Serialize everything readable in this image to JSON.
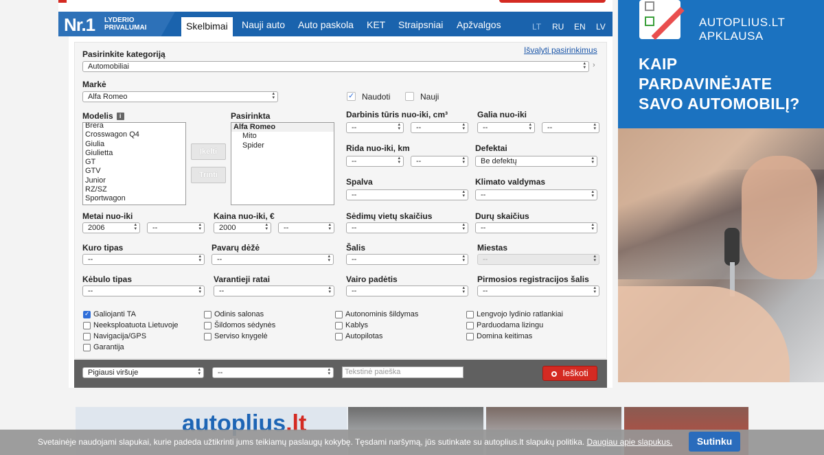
{
  "nav": {
    "logo_nr": "Nr.1",
    "logo_line1": "LYDERIO",
    "logo_line2": "PRIVALUMAI",
    "items": [
      "Skelbimai",
      "Nauji auto",
      "Auto paskola",
      "KET",
      "Straipsniai",
      "Apžvalgos"
    ],
    "languages": [
      "LT",
      "RU",
      "EN",
      "LV"
    ]
  },
  "form": {
    "category_label": "Pasirinkite kategoriją",
    "category_value": "Automobiliai",
    "clear_link": "Išvalyti pasirinkimus",
    "make_label": "Markė",
    "make_value": "Alfa Romeo",
    "used_label": "Naudoti",
    "new_label": "Nauji",
    "model_label": "Modelis",
    "models": [
      "Brera",
      "Crosswagon Q4",
      "Giulia",
      "Giulietta",
      "GT",
      "GTV",
      "Junior",
      "RZ/SZ",
      "Sportwagon"
    ],
    "insert_btn": "Įkelti",
    "delete_btn": "Trinti",
    "selection_label": "Pasirinkta",
    "selection": [
      "Alfa Romeo",
      "Mito",
      "Spider"
    ],
    "engine_label": "Darbinis tūris nuo-iki, cm³",
    "power_label": "Galia nuo-iki",
    "mileage_label": "Rida nuo-iki, km",
    "defects_label": "Defektai",
    "defects_value": "Be defektų",
    "color_label": "Spalva",
    "climate_label": "Klimato valdymas",
    "year_label": "Metai nuo-iki",
    "year_from": "2006",
    "price_label": "Kaina nuo-iki, €",
    "price_from": "2000",
    "seats_label": "Sėdimų vietų skaičius",
    "doors_label": "Durų skaičius",
    "fuel_label": "Kuro tipas",
    "gearbox_label": "Pavarų dėžė",
    "country_label": "Šalis",
    "city_label": "Miestas",
    "body_label": "Kėbulo tipas",
    "drive_label": "Varantieji ratai",
    "steering_label": "Vairo padėtis",
    "reg_country_label": "Pirmosios registracijos šalis",
    "empty": "--",
    "checkboxes": [
      {
        "label": "Galiojanti TA",
        "checked": true
      },
      {
        "label": "Odinis salonas",
        "checked": false
      },
      {
        "label": "Autonominis šildymas",
        "checked": false
      },
      {
        "label": "Lengvojo lydinio ratlankiai",
        "checked": false
      },
      {
        "label": "Neeksploatuota Lietuvoje",
        "checked": false
      },
      {
        "label": "Šildomos sėdynės",
        "checked": false
      },
      {
        "label": "Kablys",
        "checked": false
      },
      {
        "label": "Parduodama lizingu",
        "checked": false
      },
      {
        "label": "Navigacija/GPS",
        "checked": false
      },
      {
        "label": "Serviso knygelė",
        "checked": false
      },
      {
        "label": "Autopilotas",
        "checked": false
      },
      {
        "label": "Domina keitimas",
        "checked": false
      },
      {
        "label": "Garantija",
        "checked": false
      }
    ]
  },
  "bottom": {
    "sort_value": "Pigiausi viršuje",
    "second_value": "--",
    "text_placeholder": "Tekstinė paieška",
    "search_btn": "Ieškoti"
  },
  "ad": {
    "brand1": "AUTOPLIUS.LT",
    "brand2": "APKLAUSA",
    "q1": "KAIP",
    "q2": "PARDAVINĖJATE",
    "q3": "SAVO AUTOMOBILĮ?"
  },
  "banner": {
    "logo_a": "autoplius",
    "logo_b": ".lt"
  },
  "cookie": {
    "message": "Svetainėje naudojami slapukai, kurie padeda užtikrinti jums teikiamų paslaugų kokybę. Tęsdami naršymą, jūs sutinkate su autoplius.lt slapukų politika. ",
    "more": "Daugiau apie slapukus.",
    "accept": "Sutinku"
  }
}
